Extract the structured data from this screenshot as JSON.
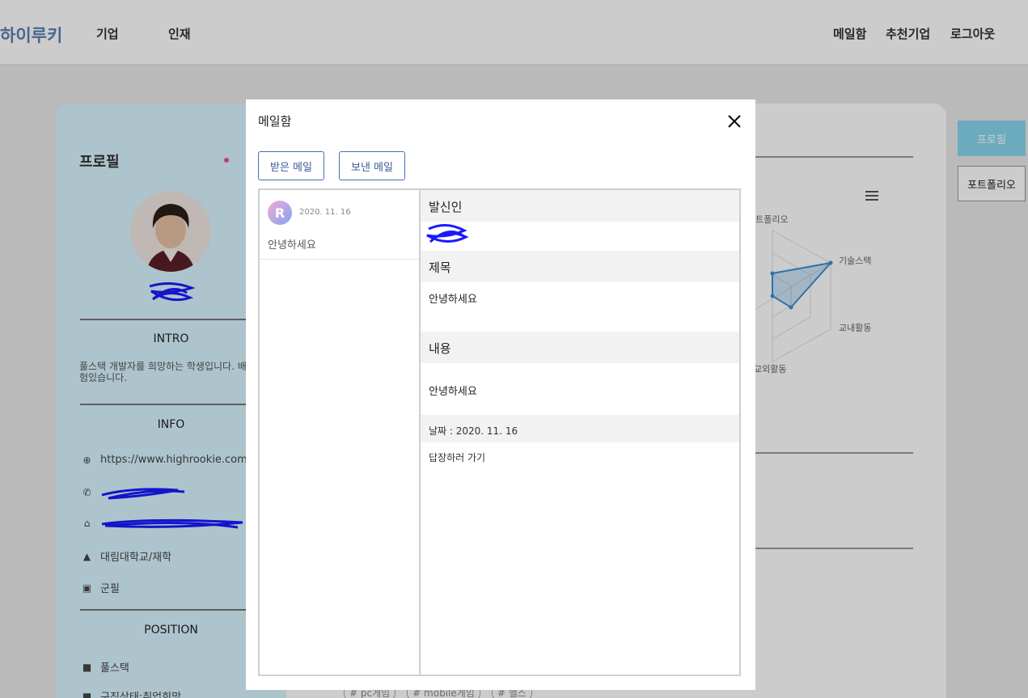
{
  "nav": {
    "brand": "하이루키",
    "links": [
      "기업",
      "인재"
    ],
    "right": [
      "메일함",
      "추천기업",
      "로그아웃"
    ]
  },
  "profile": {
    "title": "프로필",
    "intro_heading": "INTRO",
    "intro_text": "풀스택 개발자를 희망하는 학생입니다. 배포 경험있습니다.",
    "info_heading": "INFO",
    "website": "https://www.highrookie.com",
    "school": "대림대학교/재학",
    "military": "군필",
    "position_heading": "POSITION",
    "position": "풀스택",
    "job_status": "구직상태:취업희망"
  },
  "main": {
    "radar_labels": [
      "포트폴리오",
      "기술스택",
      "교내활동",
      "교외활동"
    ],
    "tags": [
      "# pc게임",
      "# mobile게임",
      "# 헬스"
    ]
  },
  "side": {
    "profile_btn": "프로필",
    "portfolio_btn": "포트폴리오"
  },
  "modal": {
    "title": "메일함",
    "received_tab": "받은 메일",
    "sent_tab": "보낸 메일",
    "mails": [
      {
        "avatar_letter": "R",
        "date": "2020. 11. 16",
        "subject": "안녕하세요"
      }
    ],
    "detail": {
      "sender_label": "발신인",
      "subject_label": "제목",
      "subject_value": "안녕하세요",
      "content_label": "내용",
      "content_value": "안녕하세요",
      "date_text": "날짜 : 2020. 11. 16",
      "reply_link": "답장하러 가기"
    }
  },
  "colors": {
    "brand": "#5b80b4",
    "profile_bg": "#d9f6ff",
    "accent": "#87d6ef",
    "radar_stroke": "#3b8fd9"
  }
}
